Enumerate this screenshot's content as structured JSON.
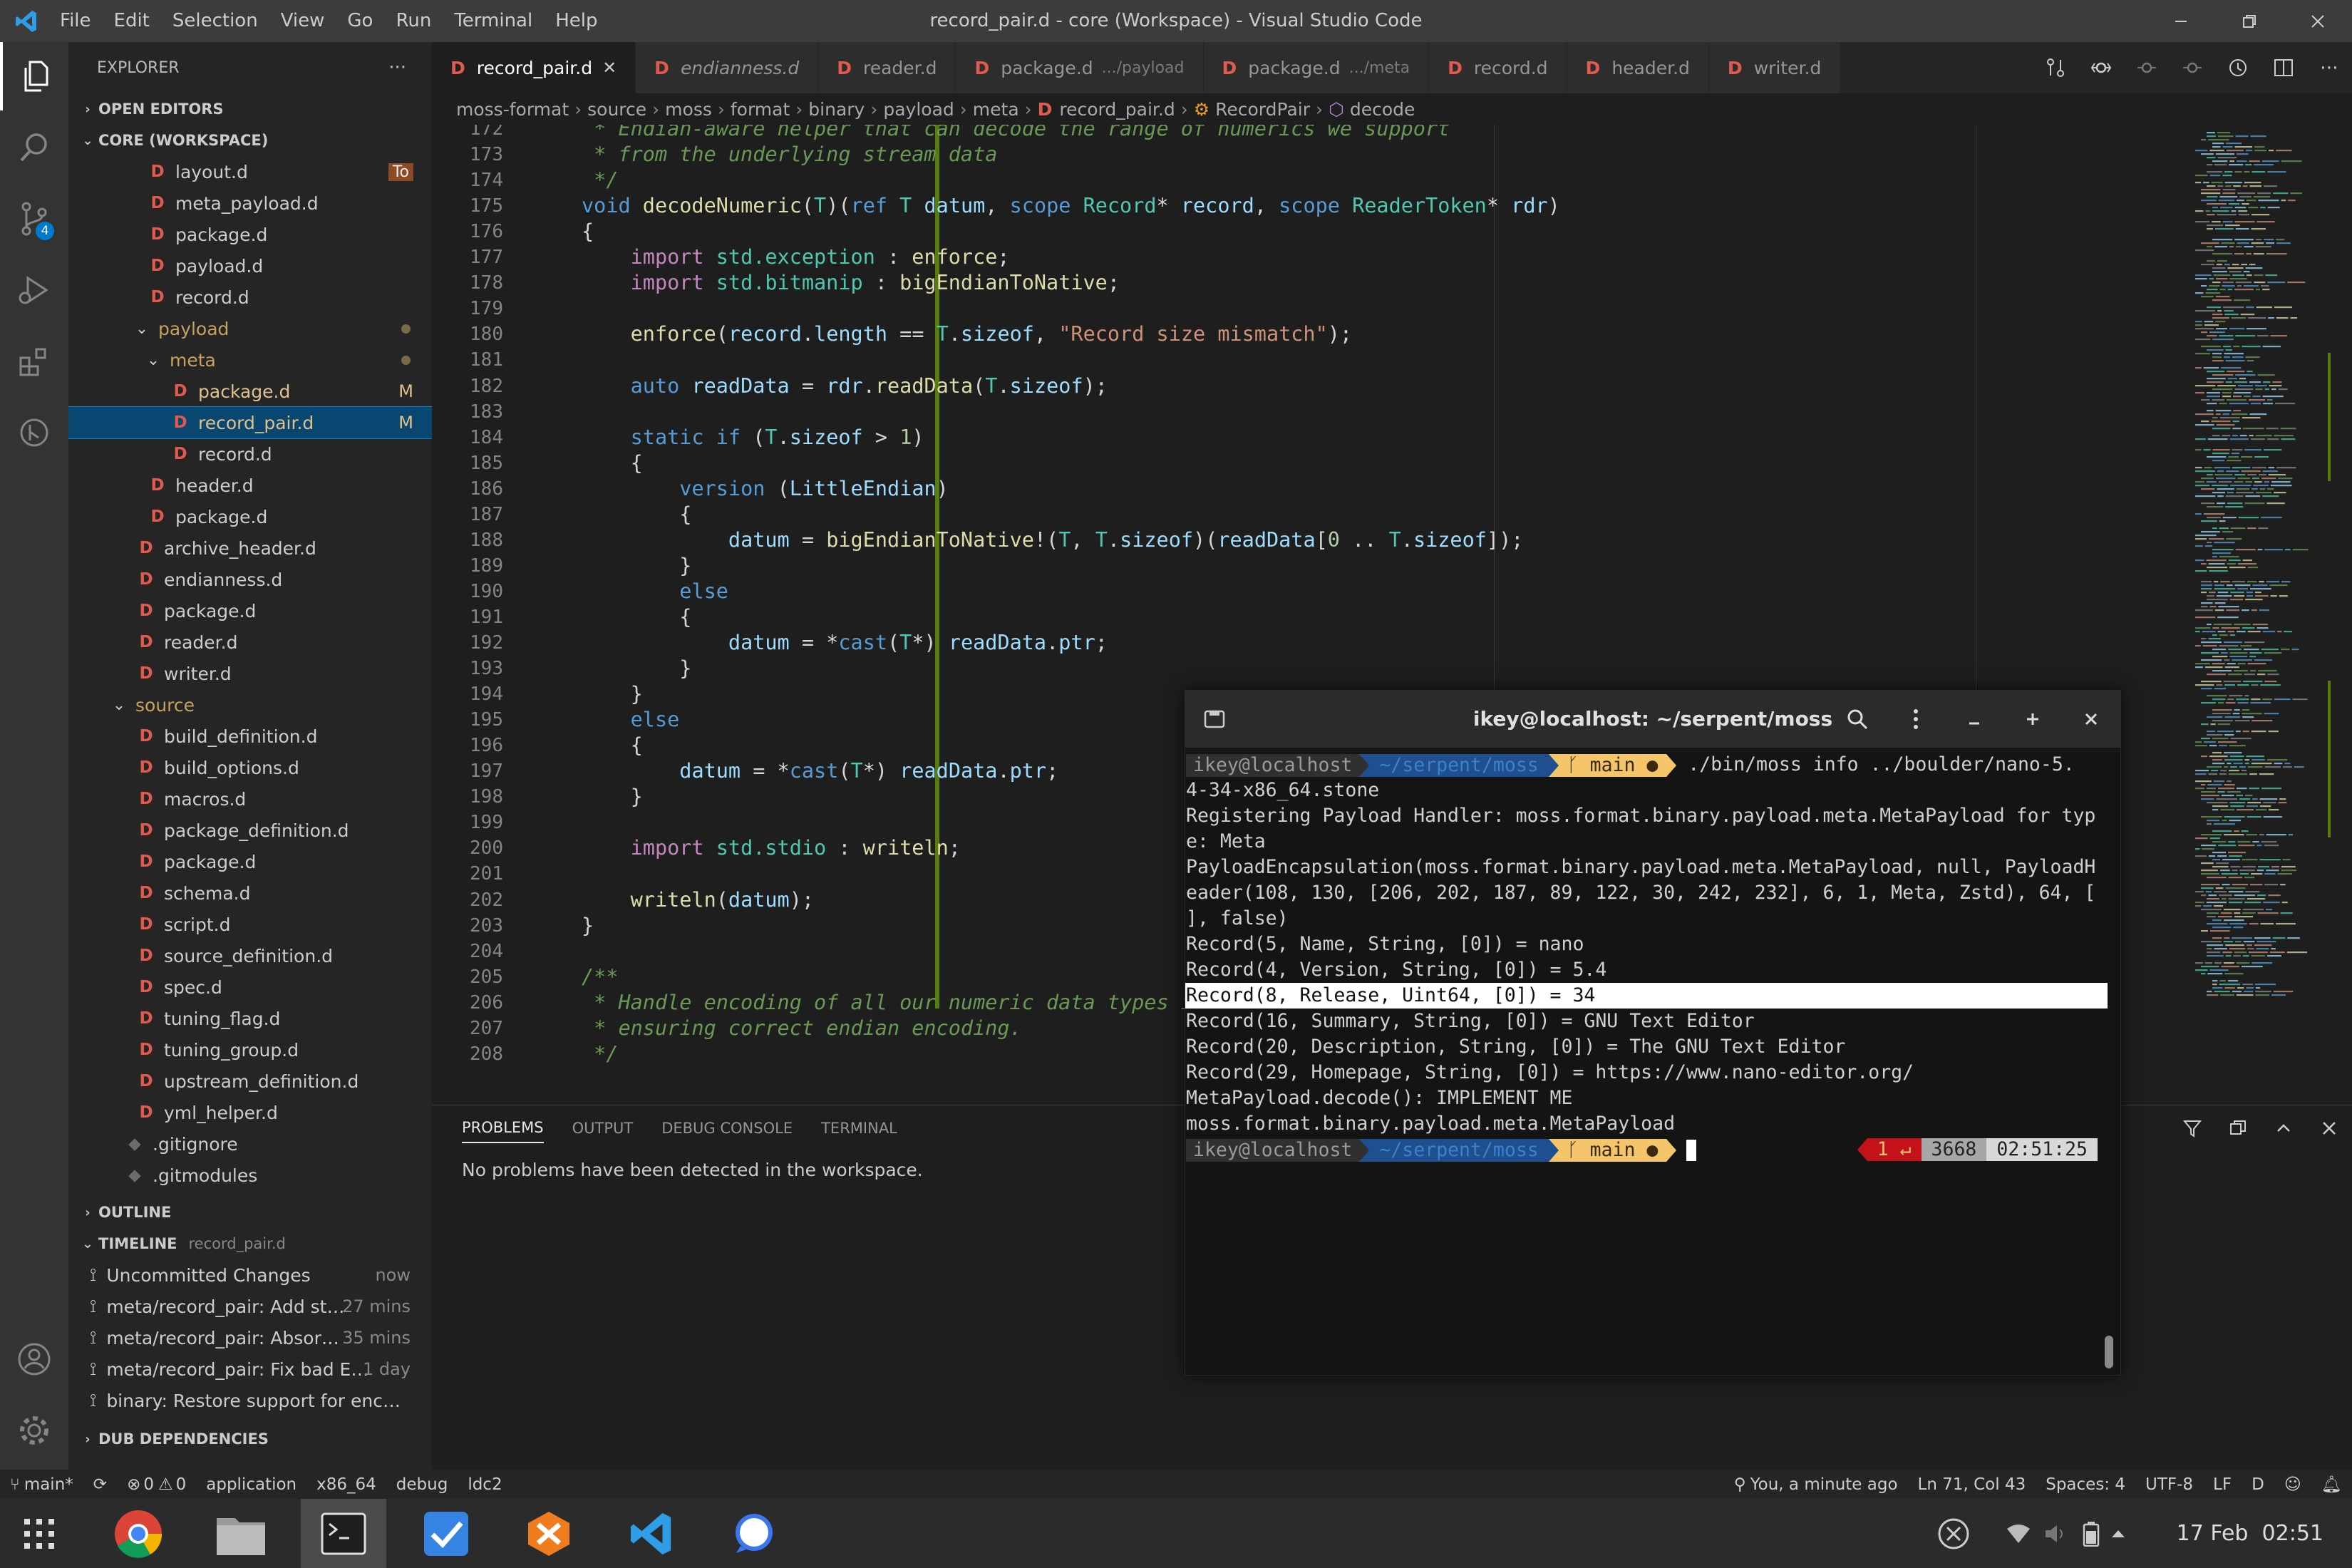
{
  "window": {
    "menu": [
      "File",
      "Edit",
      "Selection",
      "View",
      "Go",
      "Run",
      "Terminal",
      "Help"
    ],
    "title": "record_pair.d - core (Workspace) - Visual Studio Code"
  },
  "activity": {
    "scm_badge": "4"
  },
  "sidebar": {
    "explorer_title": "EXPLORER",
    "more": "···",
    "open_editors": "OPEN EDITORS",
    "workspace": "CORE (WORKSPACE)",
    "tree": [
      {
        "name": "layout.d",
        "indent": 0,
        "type": "file",
        "deco": "To"
      },
      {
        "name": "meta_payload.d",
        "indent": 0,
        "type": "file"
      },
      {
        "name": "package.d",
        "indent": 0,
        "type": "file"
      },
      {
        "name": "payload.d",
        "indent": 0,
        "type": "file"
      },
      {
        "name": "record.d",
        "indent": 0,
        "type": "file"
      },
      {
        "name": "payload",
        "indent": 0,
        "type": "folder",
        "open": true,
        "dot": true
      },
      {
        "name": "meta",
        "indent": 1,
        "type": "folder",
        "open": true,
        "dot": true
      },
      {
        "name": "package.d",
        "indent": 2,
        "type": "file",
        "mod": true,
        "deco": "M"
      },
      {
        "name": "record_pair.d",
        "indent": 2,
        "type": "file",
        "mod": true,
        "deco": "M",
        "selected": true
      },
      {
        "name": "record.d",
        "indent": 2,
        "type": "file"
      },
      {
        "name": "header.d",
        "indent": 0,
        "type": "file"
      },
      {
        "name": "package.d",
        "indent": 0,
        "type": "file"
      },
      {
        "name": "archive_header.d",
        "indent": -1,
        "type": "file"
      },
      {
        "name": "endianness.d",
        "indent": -1,
        "type": "file"
      },
      {
        "name": "package.d",
        "indent": -1,
        "type": "file"
      },
      {
        "name": "reader.d",
        "indent": -1,
        "type": "file"
      },
      {
        "name": "writer.d",
        "indent": -1,
        "type": "file"
      },
      {
        "name": "source",
        "indent": -2,
        "type": "folder",
        "open": true
      },
      {
        "name": "build_definition.d",
        "indent": -1,
        "type": "file"
      },
      {
        "name": "build_options.d",
        "indent": -1,
        "type": "file"
      },
      {
        "name": "macros.d",
        "indent": -1,
        "type": "file"
      },
      {
        "name": "package_definition.d",
        "indent": -1,
        "type": "file"
      },
      {
        "name": "package.d",
        "indent": -1,
        "type": "file"
      },
      {
        "name": "schema.d",
        "indent": -1,
        "type": "file"
      },
      {
        "name": "script.d",
        "indent": -1,
        "type": "file"
      },
      {
        "name": "source_definition.d",
        "indent": -1,
        "type": "file"
      },
      {
        "name": "spec.d",
        "indent": -1,
        "type": "file"
      },
      {
        "name": "tuning_flag.d",
        "indent": -1,
        "type": "file"
      },
      {
        "name": "tuning_group.d",
        "indent": -1,
        "type": "file"
      },
      {
        "name": "upstream_definition.d",
        "indent": -1,
        "type": "file"
      },
      {
        "name": "yml_helper.d",
        "indent": -1,
        "type": "file"
      },
      {
        "name": ".gitignore",
        "indent": -2,
        "type": "gitfile"
      },
      {
        "name": ".gitmodules",
        "indent": -2,
        "type": "gitfile"
      }
    ],
    "outline": "OUTLINE",
    "timeline": "TIMELINE",
    "timeline_file": "record_pair.d",
    "timeline_items": [
      {
        "text": "Uncommitted Changes",
        "when": "now"
      },
      {
        "text": "meta/record_pair: Add st…",
        "when": "27 mins"
      },
      {
        "text": "meta/record_pair: Absor…",
        "when": "35 mins"
      },
      {
        "text": "meta/record_pair: Fix bad E…",
        "when": "1 day"
      },
      {
        "text": "binary: Restore support for enc…",
        "when": ""
      }
    ],
    "dub": "DUB DEPENDENCIES"
  },
  "tabs": [
    {
      "label": "record_pair.d",
      "active": true,
      "close": "✕"
    },
    {
      "label": "endianness.d",
      "italic": true
    },
    {
      "label": "reader.d"
    },
    {
      "label": "package.d",
      "desc": ".../payload"
    },
    {
      "label": "package.d",
      "desc": ".../meta"
    },
    {
      "label": "record.d"
    },
    {
      "label": "header.d"
    },
    {
      "label": "writer.d"
    }
  ],
  "breadcrumb": [
    "moss-format",
    "source",
    "moss",
    "format",
    "binary",
    "payload",
    "meta",
    "record_pair.d",
    "RecordPair",
    "decode"
  ],
  "code": {
    "first_line": 172,
    "lines": [
      [
        [
          "cm",
          " * Endian-aware helper that can decode the range of numerics we support"
        ]
      ],
      [
        [
          "cm",
          " * from the underlying stream data"
        ]
      ],
      [
        [
          "cm",
          " */"
        ]
      ],
      [
        [
          "kw",
          "void "
        ],
        [
          "fn",
          "decodeNumeric"
        ],
        [
          "",
          "("
        ],
        [
          "ty",
          "T"
        ],
        [
          "",
          ")("
        ],
        [
          "kw",
          "ref "
        ],
        [
          "ty",
          "T "
        ],
        [
          "id",
          "datum"
        ],
        [
          "",
          ", "
        ],
        [
          "kw",
          "scope "
        ],
        [
          "ty",
          "Record"
        ],
        [
          "",
          "* "
        ],
        [
          "id",
          "record"
        ],
        [
          "",
          ", "
        ],
        [
          "kw",
          "scope "
        ],
        [
          "ty",
          "ReaderToken"
        ],
        [
          "",
          "* "
        ],
        [
          "id",
          "rdr"
        ],
        [
          "",
          ")"
        ]
      ],
      [
        [
          "",
          "{"
        ]
      ],
      [
        [
          "",
          "    "
        ],
        [
          "ctl",
          "import "
        ],
        [
          "ty",
          "std.exception"
        ],
        [
          "",
          " : "
        ],
        [
          "fn",
          "enforce"
        ],
        [
          "",
          ";"
        ]
      ],
      [
        [
          "",
          "    "
        ],
        [
          "ctl",
          "import "
        ],
        [
          "ty",
          "std.bitmanip"
        ],
        [
          "",
          " : "
        ],
        [
          "fn",
          "bigEndianToNative"
        ],
        [
          "",
          ";"
        ]
      ],
      [
        [
          "",
          ""
        ]
      ],
      [
        [
          "",
          "    "
        ],
        [
          "fn",
          "enforce"
        ],
        [
          "",
          "("
        ],
        [
          "id",
          "record"
        ],
        [
          "",
          "."
        ],
        [
          "id",
          "length"
        ],
        [
          "",
          " == "
        ],
        [
          "ty",
          "T"
        ],
        [
          "",
          "."
        ],
        [
          "id",
          "sizeof"
        ],
        [
          "",
          ", "
        ],
        [
          "str",
          "\"Record size mismatch\""
        ],
        [
          "",
          ");"
        ]
      ],
      [
        [
          "",
          ""
        ]
      ],
      [
        [
          "",
          "    "
        ],
        [
          "kw",
          "auto "
        ],
        [
          "id",
          "readData"
        ],
        [
          "",
          " = "
        ],
        [
          "id",
          "rdr"
        ],
        [
          "",
          "."
        ],
        [
          "fn",
          "readData"
        ],
        [
          "",
          "("
        ],
        [
          "ty",
          "T"
        ],
        [
          "",
          "."
        ],
        [
          "id",
          "sizeof"
        ],
        [
          "",
          ");"
        ]
      ],
      [
        [
          "",
          ""
        ]
      ],
      [
        [
          "",
          "    "
        ],
        [
          "kw",
          "static if "
        ],
        [
          "",
          "("
        ],
        [
          "ty",
          "T"
        ],
        [
          "",
          "."
        ],
        [
          "id",
          "sizeof"
        ],
        [
          "",
          " > "
        ],
        [
          "num",
          "1"
        ],
        [
          "",
          ")"
        ]
      ],
      [
        [
          "",
          "    {"
        ]
      ],
      [
        [
          "",
          "        "
        ],
        [
          "kw",
          "version "
        ],
        [
          "",
          "("
        ],
        [
          "id",
          "LittleEndian"
        ],
        [
          "",
          ")"
        ]
      ],
      [
        [
          "",
          "        {"
        ]
      ],
      [
        [
          "",
          "            "
        ],
        [
          "id",
          "datum"
        ],
        [
          "",
          " = "
        ],
        [
          "fn",
          "bigEndianToNative"
        ],
        [
          "",
          "!("
        ],
        [
          "ty",
          "T"
        ],
        [
          "",
          ", "
        ],
        [
          "ty",
          "T"
        ],
        [
          "",
          "."
        ],
        [
          "id",
          "sizeof"
        ],
        [
          "",
          ")("
        ],
        [
          "id",
          "readData"
        ],
        [
          "",
          "["
        ],
        [
          "num",
          "0"
        ],
        [
          "",
          " .. "
        ],
        [
          "ty",
          "T"
        ],
        [
          "",
          "."
        ],
        [
          "id",
          "sizeof"
        ],
        [
          "",
          "]);"
        ]
      ],
      [
        [
          "",
          "        }"
        ]
      ],
      [
        [
          "",
          "        "
        ],
        [
          "kw",
          "else"
        ]
      ],
      [
        [
          "",
          "        {"
        ]
      ],
      [
        [
          "",
          "            "
        ],
        [
          "id",
          "datum"
        ],
        [
          "",
          " = *"
        ],
        [
          "kw",
          "cast"
        ],
        [
          "",
          "("
        ],
        [
          "ty",
          "T"
        ],
        [
          "",
          "*) "
        ],
        [
          "id",
          "readData"
        ],
        [
          "",
          "."
        ],
        [
          "id",
          "ptr"
        ],
        [
          "",
          ";"
        ]
      ],
      [
        [
          "",
          "        }"
        ]
      ],
      [
        [
          "",
          "    }"
        ]
      ],
      [
        [
          "",
          "    "
        ],
        [
          "kw",
          "else"
        ]
      ],
      [
        [
          "",
          "    {"
        ]
      ],
      [
        [
          "",
          "        "
        ],
        [
          "id",
          "datum"
        ],
        [
          "",
          " = *"
        ],
        [
          "kw",
          "cast"
        ],
        [
          "",
          "("
        ],
        [
          "ty",
          "T"
        ],
        [
          "",
          "*) "
        ],
        [
          "id",
          "readData"
        ],
        [
          "",
          "."
        ],
        [
          "id",
          "ptr"
        ],
        [
          "",
          ";"
        ]
      ],
      [
        [
          "",
          "    }"
        ]
      ],
      [
        [
          "",
          ""
        ]
      ],
      [
        [
          "",
          "    "
        ],
        [
          "ctl",
          "import "
        ],
        [
          "ty",
          "std.stdio"
        ],
        [
          "",
          " : "
        ],
        [
          "fn",
          "writeln"
        ],
        [
          "",
          ";"
        ]
      ],
      [
        [
          "",
          ""
        ]
      ],
      [
        [
          "",
          "    "
        ],
        [
          "fn",
          "writeln"
        ],
        [
          "",
          "("
        ],
        [
          "id",
          "datum"
        ],
        [
          "",
          ");"
        ]
      ],
      [
        [
          "",
          "}"
        ]
      ],
      [
        [
          "",
          ""
        ]
      ],
      [
        [
          "cm",
          "/**"
        ]
      ],
      [
        [
          "cm",
          " * Handle encoding of all our numeric data types i"
        ]
      ],
      [
        [
          "cm",
          " * ensuring correct endian encoding."
        ]
      ],
      [
        [
          "cm",
          " */"
        ]
      ]
    ]
  },
  "panel": {
    "tabs": [
      "PROBLEMS",
      "OUTPUT",
      "DEBUG CONSOLE",
      "TERMINAL"
    ],
    "message": "No problems have been detected in the workspace."
  },
  "terminal": {
    "title": "ikey@localhost: ~/serpent/moss",
    "prompt_user": "ikey@localhost",
    "prompt_dir": "~/serpent/moss",
    "prompt_branch": "main ●",
    "command": "./bin/moss info ../boulder/nano-5.",
    "lines": [
      "4-34-x86_64.stone",
      "Registering Payload Handler: moss.format.binary.payload.meta.MetaPayload for typ",
      "e: Meta",
      "PayloadEncapsulation(moss.format.binary.payload.meta.MetaPayload, null, PayloadH",
      "eader(108, 130, [206, 202, 187, 89, 122, 30, 242, 232], 6, 1, Meta, Zstd), 64, [",
      "], false)",
      "Record(5, Name, String, [0]) = nano",
      "Record(4, Version, String, [0]) = 5.4",
      "Record(8, Release, Uint64, [0]) = 34",
      "Record(16, Summary, String, [0]) = GNU Text Editor",
      "Record(20, Description, String, [0]) = The GNU Text Editor",
      "Record(29, Homepage, String, [0]) = https://www.nano-editor.org/",
      "MetaPayload.decode(): IMPLEMENT ME",
      "moss.format.binary.payload.meta.MetaPayload"
    ],
    "highlight_index": 8,
    "status_err": "1 ↵",
    "status_num": "3668",
    "status_time": "02:51:25"
  },
  "statusbar": {
    "branch": "main*",
    "errors": "0",
    "warnings": "0",
    "items_left": [
      "application",
      "x86_64",
      "debug",
      "ldc2"
    ],
    "blame": "You, a minute ago",
    "position": "Ln 71, Col 43",
    "spaces": "Spaces: 4",
    "encoding": "UTF-8",
    "eol": "LF",
    "lang": "D"
  },
  "taskbar": {
    "date": "17 Feb",
    "time": "02:51"
  }
}
